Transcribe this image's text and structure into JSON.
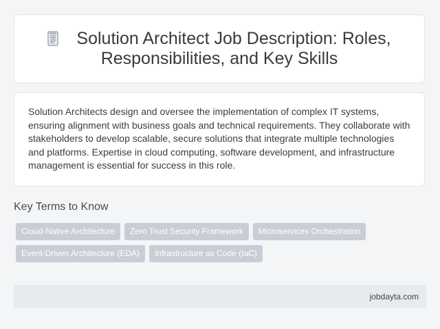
{
  "header": {
    "icon": "document-icon",
    "title": "Solution Architect Job Description: Roles, Responsibilities, and Key Skills"
  },
  "intro": {
    "text": "Solution Architects design and oversee the implementation of complex IT systems, ensuring alignment with business goals and technical requirements. They collaborate with stakeholders to develop scalable, secure solutions that integrate multiple technologies and platforms. Expertise in cloud computing, software development, and infrastructure management is essential for success in this role."
  },
  "key_terms": {
    "heading": "Key Terms to Know",
    "tags": [
      "Cloud-Native Architecture",
      "Zero Trust Security Framework",
      "Microservices Orchestration",
      "Event-Driven Architecture (EDA)",
      "Infrastructure as Code (IaC)"
    ]
  },
  "footer": {
    "site": "jobdayta.com"
  },
  "colors": {
    "page_background": "#f3f5f7",
    "tag_background": "#c9ced6",
    "footer_background": "#e6ebee"
  }
}
